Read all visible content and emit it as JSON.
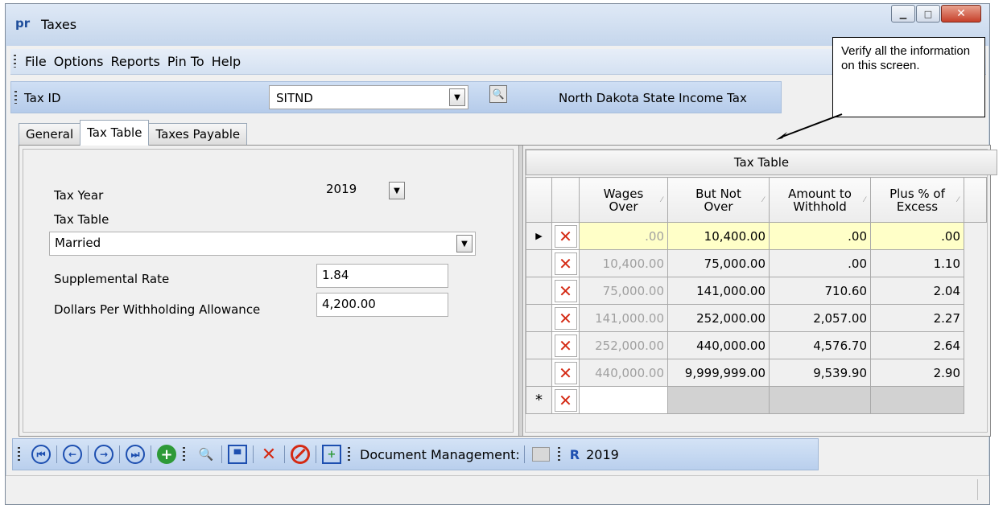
{
  "window": {
    "app_icon": "pr",
    "title": "Taxes"
  },
  "menu": [
    "File",
    "Options",
    "Reports",
    "Pin To",
    "Help"
  ],
  "taxid": {
    "label": "Tax ID",
    "value": "SITND",
    "description": "North Dakota State Income Tax"
  },
  "tabs": [
    "General",
    "Tax Table",
    "Taxes Payable"
  ],
  "active_tab": "Tax Table",
  "form": {
    "tax_year_label": "Tax Year",
    "tax_year_value": "2019",
    "tax_table_label": "Tax Table",
    "tax_table_value": "Married",
    "supplemental_label": "Supplemental Rate",
    "supplemental_value": "1.84",
    "dollars_label": "Dollars Per Withholding Allowance",
    "dollars_value": "4,200.00"
  },
  "grid": {
    "caption": "Tax Table",
    "headers": [
      [
        "Wages",
        "Over"
      ],
      [
        "But Not",
        "Over"
      ],
      [
        "Amount to",
        "Withhold"
      ],
      [
        "Plus % of",
        "Excess"
      ]
    ],
    "rows": [
      [
        ".00",
        "10,400.00",
        ".00",
        ".00"
      ],
      [
        "10,400.00",
        "75,000.00",
        ".00",
        "1.10"
      ],
      [
        "75,000.00",
        "141,000.00",
        "710.60",
        "2.04"
      ],
      [
        "141,000.00",
        "252,000.00",
        "2,057.00",
        "2.27"
      ],
      [
        "252,000.00",
        "440,000.00",
        "4,576.70",
        "2.64"
      ],
      [
        "440,000.00",
        "9,999,999.00",
        "9,539.90",
        "2.90"
      ]
    ]
  },
  "toolbar": {
    "doc_mgmt": "Document Management:",
    "year": "2019"
  },
  "callout": "Verify all the information on this screen.",
  "icons": {
    "first": "first-record-icon",
    "prev": "previous-record-icon",
    "next": "next-record-icon",
    "last": "last-record-icon",
    "add": "add-icon",
    "find": "binoculars-icon",
    "save": "save-icon",
    "delete": "delete-icon",
    "cancel": "cancel-icon",
    "save_new": "save-new-icon"
  }
}
